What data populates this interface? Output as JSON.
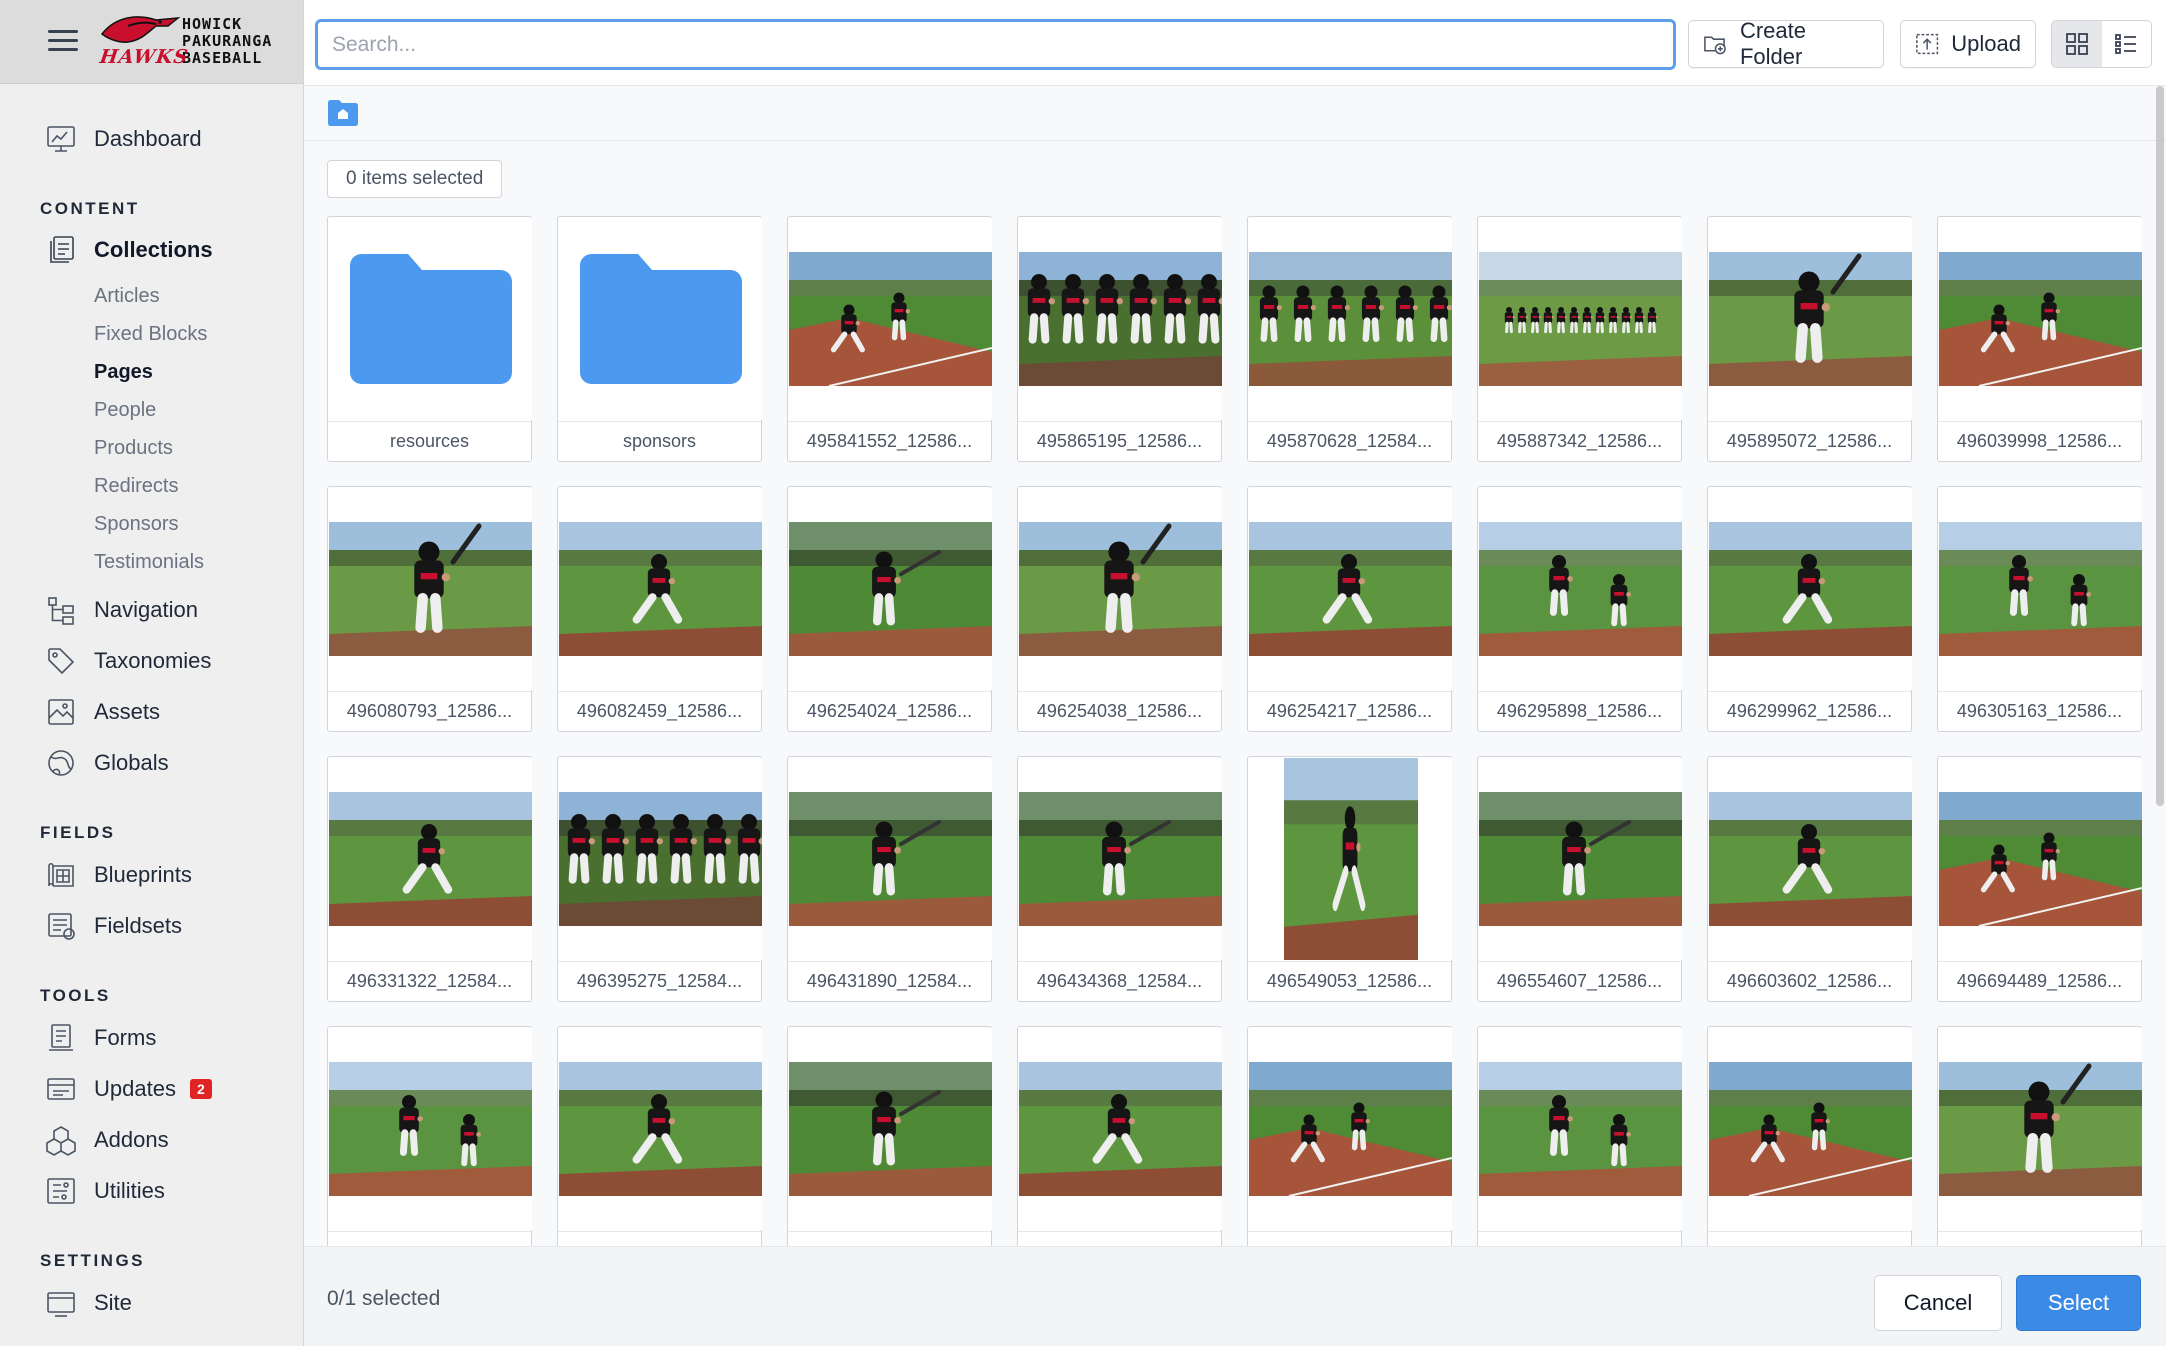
{
  "brand": {
    "wordmark_lines": [
      "HOWICK",
      "PAKURANGA",
      "BASEBALL"
    ],
    "script": "HAWKS",
    "colors": {
      "red": "#c8102e",
      "dark": "#111111"
    }
  },
  "sidebar": {
    "dashboard": "Dashboard",
    "sections": {
      "content": "CONTENT",
      "fields": "FIELDS",
      "tools": "TOOLS",
      "settings": "SETTINGS"
    },
    "collections": "Collections",
    "collection_items": [
      "Articles",
      "Fixed Blocks",
      "Pages",
      "People",
      "Products",
      "Redirects",
      "Sponsors",
      "Testimonials"
    ],
    "current_collection": "Pages",
    "navigation": "Navigation",
    "taxonomies": "Taxonomies",
    "assets": "Assets",
    "globals": "Globals",
    "blueprints": "Blueprints",
    "fieldsets": "Fieldsets",
    "forms": "Forms",
    "updates": "Updates",
    "updates_badge": "2",
    "addons": "Addons",
    "utilities": "Utilities",
    "site": "Site"
  },
  "header": {
    "search_placeholder": "Search...",
    "create_folder": "Create Folder",
    "upload": "Upload",
    "view_mode": "grid"
  },
  "selection": {
    "items_selected": "0 items selected",
    "footer_status": "0/1 selected"
  },
  "actions": {
    "cancel": "Cancel",
    "select": "Select"
  },
  "colors": {
    "accent": "#3b8ae6",
    "folder": "#4b9af0",
    "badge": "#e02424"
  },
  "assets": [
    {
      "label": "resources",
      "kind": "folder"
    },
    {
      "label": "sponsors",
      "kind": "folder"
    },
    {
      "label": "495841552_12586...",
      "kind": "image",
      "variant": "infield-slide"
    },
    {
      "label": "495865195_12586...",
      "kind": "image",
      "variant": "fence-highfive"
    },
    {
      "label": "495870628_12584...",
      "kind": "image",
      "variant": "team-line"
    },
    {
      "label": "495887342_12586...",
      "kind": "image",
      "variant": "team-distance"
    },
    {
      "label": "495895072_12586...",
      "kind": "image",
      "variant": "batter-closeup"
    },
    {
      "label": "496039998_12586...",
      "kind": "image",
      "variant": "infield-slide"
    },
    {
      "label": "496080793_12586...",
      "kind": "image",
      "variant": "batter-closeup"
    },
    {
      "label": "496082459_12586...",
      "kind": "image",
      "variant": "pitcher"
    },
    {
      "label": "496254024_12586...",
      "kind": "image",
      "variant": "batter-swing"
    },
    {
      "label": "496254038_12586...",
      "kind": "image",
      "variant": "batter-closeup"
    },
    {
      "label": "496254217_12586...",
      "kind": "image",
      "variant": "pitcher"
    },
    {
      "label": "496295898_12586...",
      "kind": "image",
      "variant": "catcher"
    },
    {
      "label": "496299962_12586...",
      "kind": "image",
      "variant": "pitcher"
    },
    {
      "label": "496305163_12586...",
      "kind": "image",
      "variant": "catcher"
    },
    {
      "label": "496331322_12584...",
      "kind": "image",
      "variant": "pitcher"
    },
    {
      "label": "496395275_12584...",
      "kind": "image",
      "variant": "fence-highfive"
    },
    {
      "label": "496431890_12584...",
      "kind": "image",
      "variant": "batter-swing"
    },
    {
      "label": "496434368_12584...",
      "kind": "image",
      "variant": "batter-swing"
    },
    {
      "label": "496549053_12586...",
      "kind": "image",
      "variant": "pitcher",
      "portrait": true
    },
    {
      "label": "496554607_12586...",
      "kind": "image",
      "variant": "batter-swing"
    },
    {
      "label": "496603602_12586...",
      "kind": "image",
      "variant": "pitcher"
    },
    {
      "label": "496694489_12586...",
      "kind": "image",
      "variant": "infield-slide"
    },
    {
      "label": "",
      "kind": "image",
      "variant": "catcher"
    },
    {
      "label": "",
      "kind": "image",
      "variant": "pitcher"
    },
    {
      "label": "",
      "kind": "image",
      "variant": "batter-swing"
    },
    {
      "label": "",
      "kind": "image",
      "variant": "pitcher"
    },
    {
      "label": "",
      "kind": "image",
      "variant": "infield-slide"
    },
    {
      "label": "",
      "kind": "image",
      "variant": "catcher"
    },
    {
      "label": "",
      "kind": "image",
      "variant": "infield-slide"
    },
    {
      "label": "",
      "kind": "image",
      "variant": "batter-closeup"
    }
  ]
}
